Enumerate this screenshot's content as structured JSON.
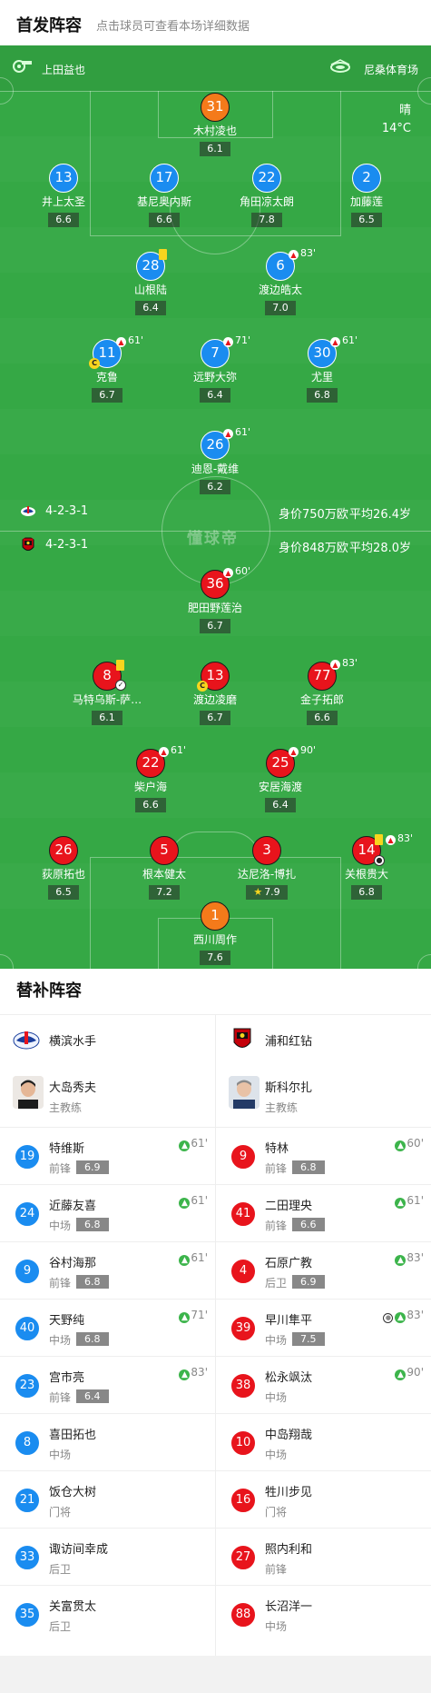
{
  "header": {
    "title": "首发阵容",
    "subtitle": "点击球员可查看本场详细数据"
  },
  "pitch": {
    "referee": "上田益也",
    "venue": "尼桑体育场",
    "weather": "晴",
    "temperature": "14°C",
    "watermark": "懂球帝"
  },
  "teams": {
    "home": {
      "name": "横滨水手",
      "formation": "4-2-3-1",
      "value": "身价750万欧",
      "avg_age": "平均26.4岁",
      "color": "#1a8cf0"
    },
    "away": {
      "name": "浦和红钻",
      "formation": "4-2-3-1",
      "value": "身价848万欧",
      "avg_age": "平均28.0岁",
      "color": "#e8141c"
    }
  },
  "home_players": [
    {
      "num": "31",
      "name": "木村凌也",
      "rating": "6.1",
      "gk": true
    },
    {
      "num": "13",
      "name": "井上太圣",
      "rating": "6.6"
    },
    {
      "num": "17",
      "name": "基尼奥内斯",
      "rating": "6.6"
    },
    {
      "num": "22",
      "name": "角田凉太朗",
      "rating": "7.8"
    },
    {
      "num": "2",
      "name": "加藤莲",
      "rating": "6.5"
    },
    {
      "num": "28",
      "name": "山根陆",
      "rating": "6.4"
    },
    {
      "num": "6",
      "name": "渡边皓太",
      "rating": "7.0",
      "sub": "83'"
    },
    {
      "num": "11",
      "name": "克鲁",
      "rating": "6.7",
      "sub": "61'"
    },
    {
      "num": "7",
      "name": "远野大弥",
      "rating": "6.4",
      "sub": "71'"
    },
    {
      "num": "30",
      "name": "尤里",
      "rating": "6.8",
      "sub": "61'"
    },
    {
      "num": "26",
      "name": "迪恩-戴维",
      "rating": "6.2",
      "sub": "61'"
    }
  ],
  "away_players": [
    {
      "num": "36",
      "name": "肥田野莲治",
      "rating": "6.7",
      "sub": "60'"
    },
    {
      "num": "8",
      "name": "马特乌斯-萨…",
      "rating": "6.1"
    },
    {
      "num": "13",
      "name": "渡边凌磨",
      "rating": "6.7"
    },
    {
      "num": "77",
      "name": "金子拓郎",
      "rating": "6.6",
      "sub": "83'"
    },
    {
      "num": "22",
      "name": "柴户海",
      "rating": "6.6",
      "sub": "61'"
    },
    {
      "num": "25",
      "name": "安居海渡",
      "rating": "6.4",
      "sub": "90'"
    },
    {
      "num": "26",
      "name": "荻原拓也",
      "rating": "6.5"
    },
    {
      "num": "5",
      "name": "根本健太",
      "rating": "7.2"
    },
    {
      "num": "3",
      "name": "达尼洛-博扎",
      "rating": "7.9",
      "star": true
    },
    {
      "num": "14",
      "name": "关根贵大",
      "rating": "6.8",
      "sub": "83'"
    },
    {
      "num": "1",
      "name": "西川周作",
      "rating": "7.6",
      "gk": true
    }
  ],
  "subs": {
    "title": "替补阵容",
    "home_coach": {
      "name": "大岛秀夫",
      "role": "主教练"
    },
    "away_coach": {
      "name": "斯科尔扎",
      "role": "主教练"
    },
    "home": [
      {
        "num": "19",
        "name": "特维斯",
        "pos": "前锋",
        "rating": "6.9",
        "minute": "61'"
      },
      {
        "num": "24",
        "name": "近藤友喜",
        "pos": "中场",
        "rating": "6.8",
        "minute": "61'"
      },
      {
        "num": "9",
        "name": "谷村海那",
        "pos": "前锋",
        "rating": "6.8",
        "minute": "61'"
      },
      {
        "num": "40",
        "name": "天野纯",
        "pos": "中场",
        "rating": "6.8",
        "minute": "71'"
      },
      {
        "num": "23",
        "name": "宫市亮",
        "pos": "前锋",
        "rating": "6.4",
        "minute": "83'"
      },
      {
        "num": "8",
        "name": "喜田拓也",
        "pos": "中场"
      },
      {
        "num": "21",
        "name": "饭仓大树",
        "pos": "门将"
      },
      {
        "num": "33",
        "name": "诹访间幸成",
        "pos": "后卫"
      },
      {
        "num": "35",
        "name": "关富贯太",
        "pos": "后卫"
      }
    ],
    "away": [
      {
        "num": "9",
        "name": "特林",
        "pos": "前锋",
        "rating": "6.8",
        "minute": "60'"
      },
      {
        "num": "41",
        "name": "二田理央",
        "pos": "前锋",
        "rating": "6.6",
        "minute": "61'"
      },
      {
        "num": "4",
        "name": "石原广教",
        "pos": "后卫",
        "rating": "6.9",
        "minute": "83'"
      },
      {
        "num": "39",
        "name": "早川隼平",
        "pos": "中场",
        "rating": "7.5",
        "minute": "83'",
        "goal": true
      },
      {
        "num": "38",
        "name": "松永飒汰",
        "pos": "中场",
        "minute": "90'"
      },
      {
        "num": "10",
        "name": "中岛翔哉",
        "pos": "中场"
      },
      {
        "num": "16",
        "name": "牲川步见",
        "pos": "门将"
      },
      {
        "num": "27",
        "name": "照内利和",
        "pos": "前锋"
      },
      {
        "num": "88",
        "name": "长沼洋一",
        "pos": "中场"
      }
    ]
  }
}
